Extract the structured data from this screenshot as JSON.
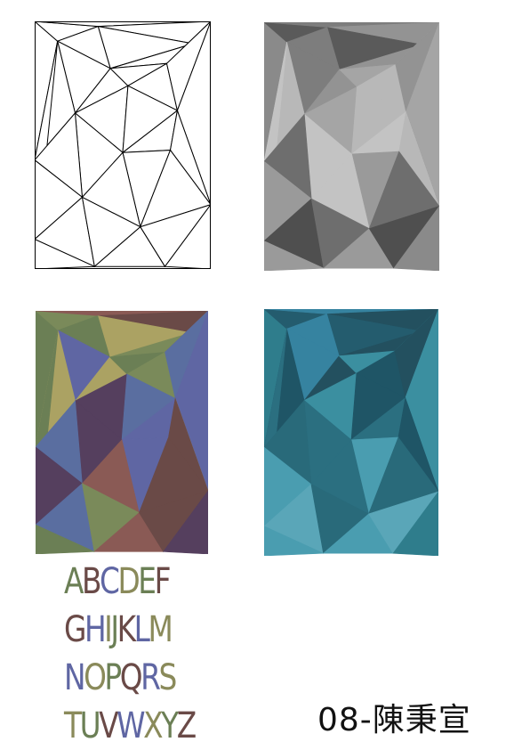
{
  "alphabet_lines": [
    "ABCDEF",
    "GHIJKLM",
    "NOPQRS",
    "TUVWXYZ"
  ],
  "signature": "08-陳秉宣",
  "palettes": {
    "outline": {
      "stroke": "#000000",
      "fill": "#ffffff"
    },
    "gray": [
      "#8a8a8a",
      "#6e6e6e",
      "#a5a5a5",
      "#5a5a5a",
      "#9a9a9a",
      "#b8b8b8",
      "#7d7d7d",
      "#4f4f4f",
      "#c3c3c3",
      "#939393"
    ],
    "color": [
      "#6b7f55",
      "#6a4a47",
      "#5f66a3",
      "#7a8a5a",
      "#553f5e",
      "#aba263",
      "#8a5a55",
      "#5a6ea0"
    ],
    "teal": [
      "#2f7d8c",
      "#296a7a",
      "#3b8fa0",
      "#245c6e",
      "#4a9db0",
      "#1f5566",
      "#3683a0",
      "#5aa6b8",
      "#2b6f80",
      "#23505f"
    ]
  },
  "alphabet_colors": [
    "#6b7f55",
    "#6a4a47",
    "#5f66a3",
    "#8a8a5a"
  ]
}
